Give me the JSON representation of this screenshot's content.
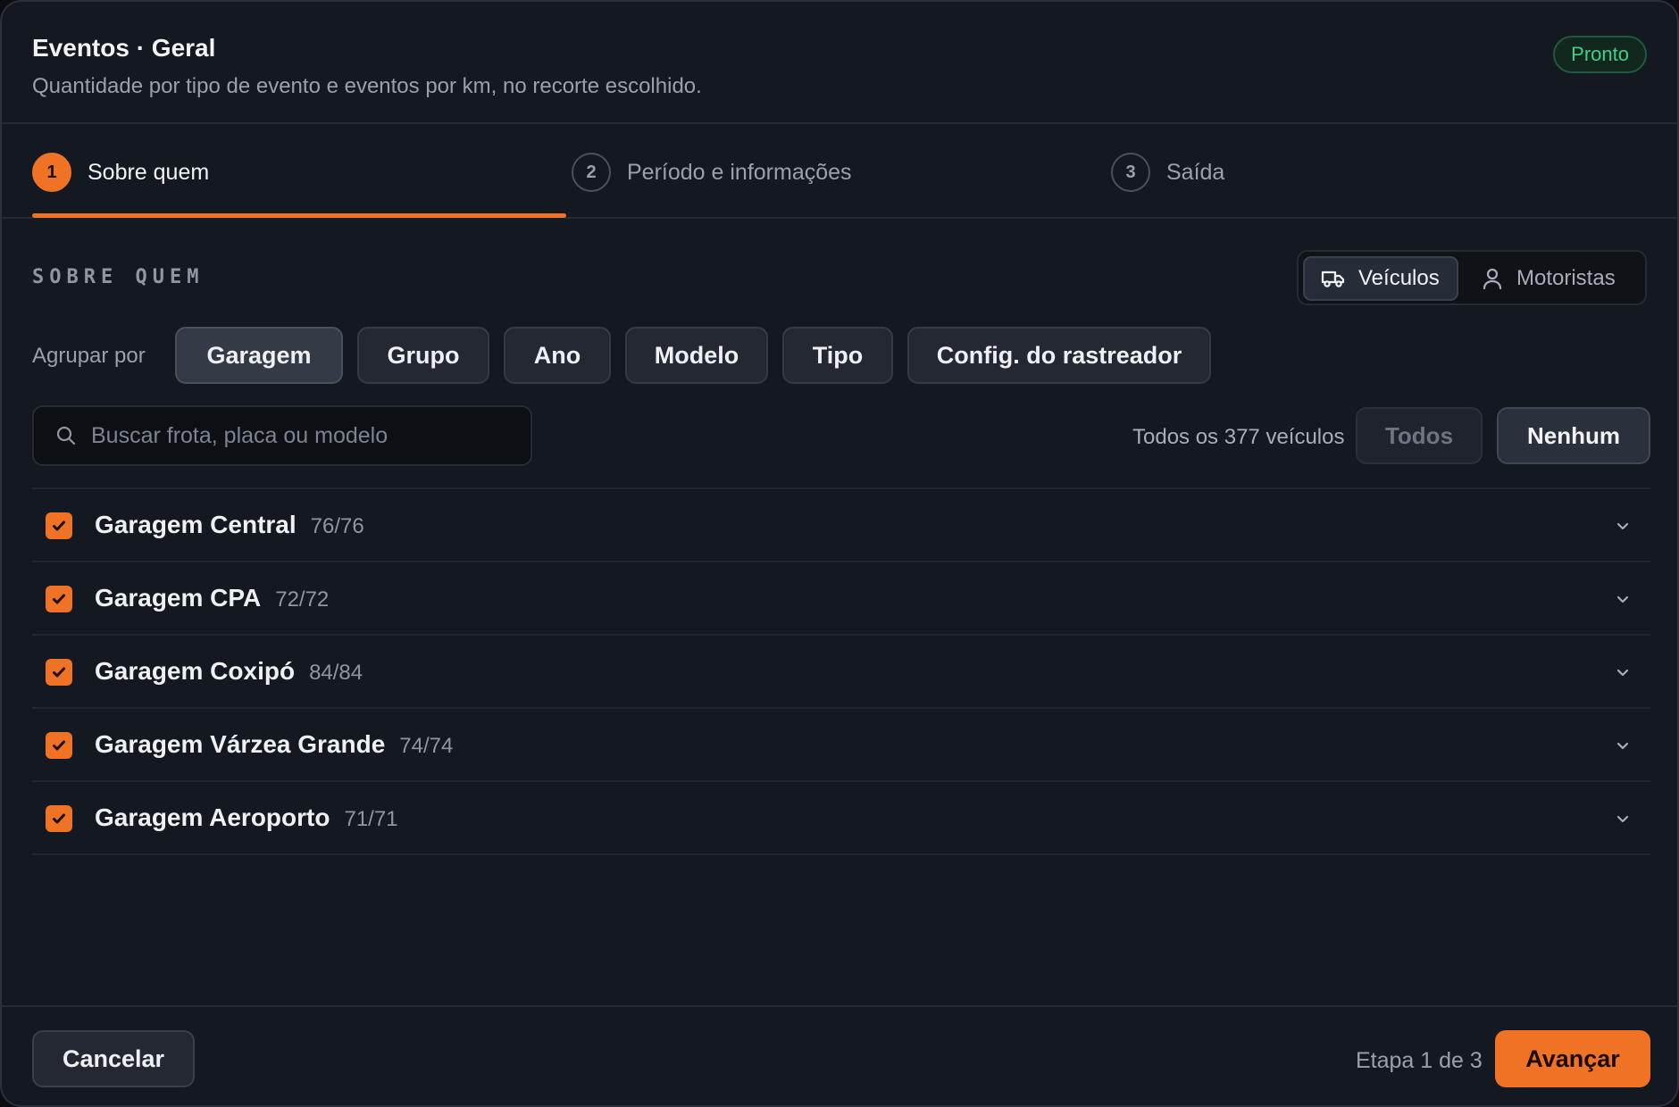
{
  "header": {
    "title": "Eventos · Geral",
    "subtitle": "Quantidade por tipo de evento e eventos por km, no recorte escolhido.",
    "status_badge": "Pronto"
  },
  "steps": [
    {
      "number": "1",
      "label": "Sobre quem",
      "active": true
    },
    {
      "number": "2",
      "label": "Período e informações",
      "active": false
    },
    {
      "number": "3",
      "label": "Saída",
      "active": false
    }
  ],
  "section": {
    "title": "SOBRE QUEM",
    "toggle": [
      {
        "label": "Veículos",
        "icon": "truck-icon",
        "selected": true
      },
      {
        "label": "Motoristas",
        "icon": "person-icon",
        "selected": false
      }
    ]
  },
  "group_by": {
    "label": "Agrupar por",
    "options": [
      {
        "label": "Garagem",
        "selected": true
      },
      {
        "label": "Grupo",
        "selected": false
      },
      {
        "label": "Ano",
        "selected": false
      },
      {
        "label": "Modelo",
        "selected": false
      },
      {
        "label": "Tipo",
        "selected": false
      },
      {
        "label": "Config. do rastreador",
        "selected": false
      }
    ]
  },
  "search": {
    "placeholder": "Buscar frota, placa ou modelo",
    "value": ""
  },
  "selection": {
    "summary": "Todos os 377 veículos",
    "all_label": "Todos",
    "none_label": "Nenhum"
  },
  "groups": [
    {
      "name": "Garagem Central",
      "count": "76/76",
      "checked": true
    },
    {
      "name": "Garagem CPA",
      "count": "72/72",
      "checked": true
    },
    {
      "name": "Garagem Coxipó",
      "count": "84/84",
      "checked": true
    },
    {
      "name": "Garagem Várzea Grande",
      "count": "74/74",
      "checked": true
    },
    {
      "name": "Garagem Aeroporto",
      "count": "71/71",
      "checked": true
    }
  ],
  "footer": {
    "cancel_label": "Cancelar",
    "step_info": "Etapa 1 de 3",
    "next_label": "Avançar"
  },
  "colors": {
    "accent": "#f07224",
    "background": "#141820",
    "success": "#3fd08a"
  }
}
